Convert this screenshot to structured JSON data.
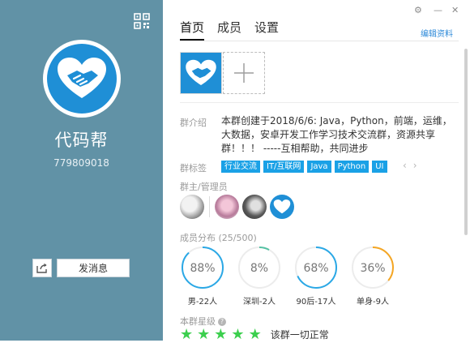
{
  "colors": {
    "left_panel": "#6192a6",
    "accent": "#1aa1e6",
    "link": "#2d8ad9",
    "star": "#3ccf4e"
  },
  "left": {
    "group_name": "代码帮",
    "group_id": "779809018",
    "send_button_label": "发消息",
    "qr_icon": "qr-code-icon",
    "share_icon": "share-icon"
  },
  "window_controls": {
    "settings_icon": "⚙",
    "minimize": "—",
    "close": "✕"
  },
  "edit_link": "编辑资料",
  "tabs": [
    {
      "label": "首页",
      "active": true
    },
    {
      "label": "成员",
      "active": false
    },
    {
      "label": "设置",
      "active": false
    }
  ],
  "intro": {
    "label": "群介绍",
    "text": "本群创建于2018/6/6: Java，Python，前端，运维，大数据，安卓开发工作学习技术交流群，资源共享群！！！ -----互相帮助，共同进步"
  },
  "tags": {
    "label": "群标签",
    "items": [
      "行业交流",
      "IT/互联网",
      "Java",
      "Python",
      "UI"
    ]
  },
  "admins": {
    "label": "群主/管理员"
  },
  "members": {
    "label": "成员分布 (25/500)",
    "stats": [
      {
        "value": "88%",
        "caption": "男-22人",
        "percent": 88,
        "color": "#2aa8e6"
      },
      {
        "value": "8%",
        "caption": "深圳-2人",
        "percent": 8,
        "color": "#54c1a3"
      },
      {
        "value": "68%",
        "caption": "90后-17人",
        "percent": 68,
        "color": "#2aa8e6"
      },
      {
        "value": "36%",
        "caption": "单身-9人",
        "percent": 36,
        "color": "#f5a623"
      }
    ]
  },
  "rating": {
    "label": "本群星级",
    "stars": 5,
    "text": "该群一切正常"
  }
}
